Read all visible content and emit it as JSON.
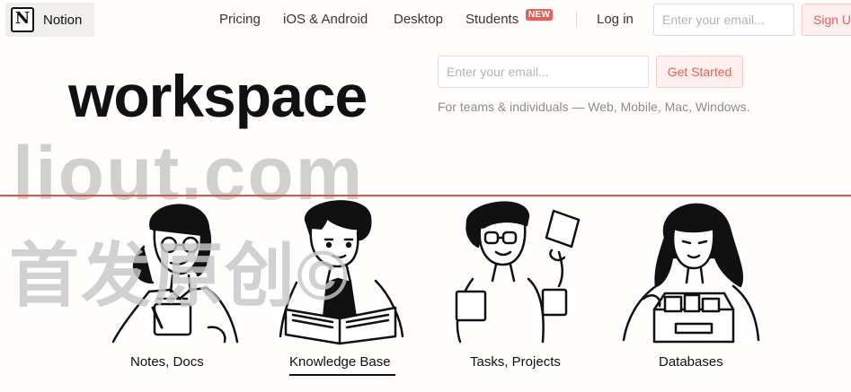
{
  "nav": {
    "brand": "Notion",
    "logo_letter": "N",
    "links": [
      "Pricing",
      "iOS & Android",
      "Desktop",
      "Students",
      "Log in"
    ],
    "badge": "NEW",
    "email_placeholder": "Enter your email...",
    "signup_label": "Sign U"
  },
  "hero": {
    "title": "workspace",
    "email_placeholder": "Enter your email...",
    "cta_label": "Get Started",
    "subtitle": "For teams & individuals — Web, Mobile, Mac, Windows."
  },
  "watermark": {
    "domain": "liout.com",
    "chinese": "首发原创©"
  },
  "features": [
    {
      "label": "Notes, Docs",
      "active": false
    },
    {
      "label": "Knowledge Base",
      "active": true
    },
    {
      "label": "Tasks, Projects",
      "active": false
    },
    {
      "label": "Databases",
      "active": false
    }
  ],
  "colors": {
    "accent": "#e16259",
    "accent_bg": "#fdf0ef",
    "rule": "#d9534f",
    "watermark": "#c8c8c8"
  },
  "icons": [
    "notion-logo-icon",
    "notes-illustration",
    "knowledge-illustration",
    "tasks-illustration",
    "databases-illustration"
  ]
}
